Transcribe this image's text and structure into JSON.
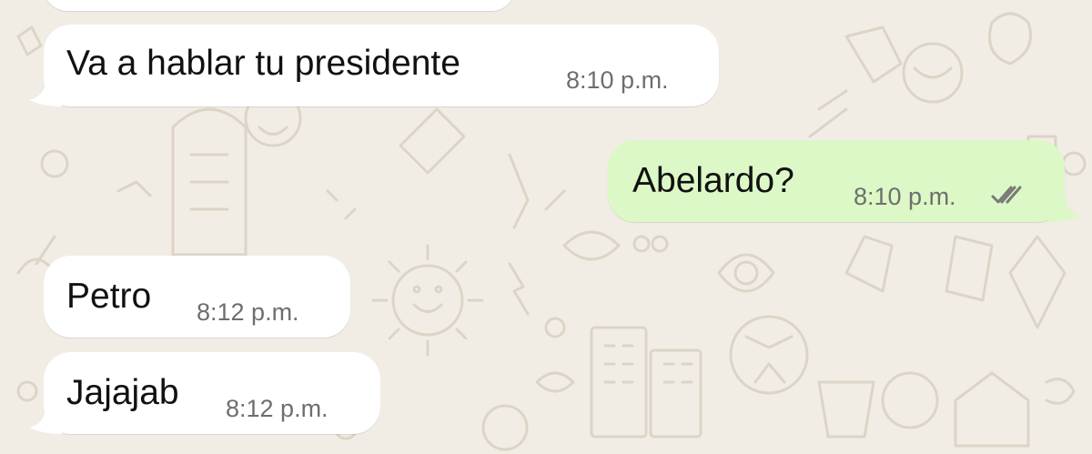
{
  "colors": {
    "incoming_bubble": "#ffffff",
    "outgoing_bubble": "#dcf8c6",
    "wallpaper": "#f1ede5",
    "read_ticks": "#7a7a7a"
  },
  "messages": [
    {
      "direction": "incoming",
      "text": "Va a hablar tu presidente",
      "time": "8:10 p.m."
    },
    {
      "direction": "outgoing",
      "text": "Abelardo?",
      "time": "8:10 p.m.",
      "status_icon": "double-check-icon"
    },
    {
      "direction": "incoming",
      "text": "Petro",
      "time": "8:12 p.m."
    },
    {
      "direction": "incoming",
      "text": "Jajajab",
      "time": "8:12 p.m."
    }
  ]
}
